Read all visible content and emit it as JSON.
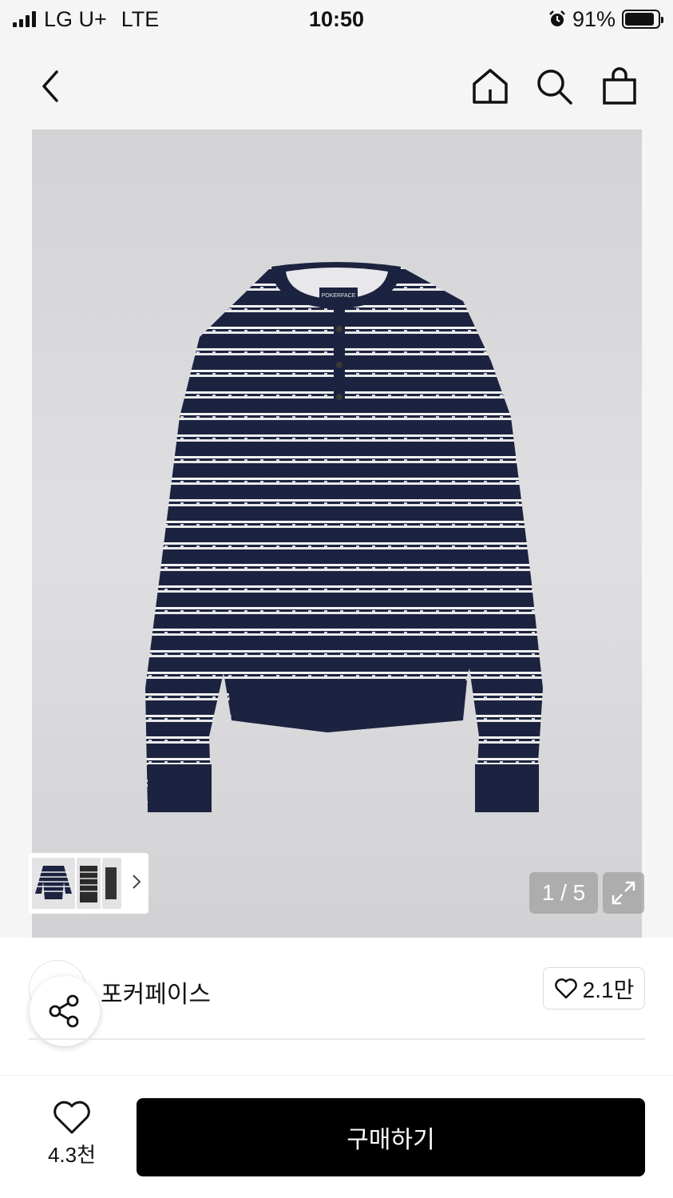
{
  "status_bar": {
    "carrier": "LG U+",
    "network": "LTE",
    "time": "10:50",
    "battery": "91%"
  },
  "nav": {
    "back_icon": "chevron-left-icon",
    "home_icon": "home-icon",
    "search_icon": "search-icon",
    "bag_icon": "shopping-bag-icon"
  },
  "gallery": {
    "counter": "1 / 5",
    "expand_icon": "expand-icon",
    "thumbs_arrow_icon": "chevron-right-icon",
    "label_text": "POKERFACE",
    "colors": {
      "navy": "#1c2340",
      "stripe": "#f2f2f2"
    }
  },
  "brand": {
    "name": "포커페이스",
    "likes": "2.1만"
  },
  "share_icon": "share-icon",
  "bottom_bar": {
    "wish_count": "4.3천",
    "buy_label": "구매하기"
  }
}
